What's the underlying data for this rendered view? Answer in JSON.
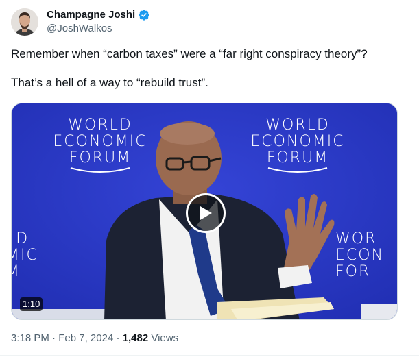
{
  "author": {
    "display_name": "Champagne Joshi",
    "handle": "@JoshWalkos",
    "verified": true,
    "avatar_icon": "profile-photo"
  },
  "tweet": {
    "lines": [
      "Remember when “carbon taxes” were a “far right conspiracy theory”?",
      "That’s a hell of a way to “rebuild trust”."
    ]
  },
  "media": {
    "type": "video",
    "duration": "1:10",
    "background_color": "#2a37c8",
    "logos": {
      "line1": "WORLD",
      "line2": "ECONOMIC",
      "line3": "FORUM",
      "left_crop": [
        "LD",
        "MIC",
        "M"
      ],
      "right_crop": [
        "WOR",
        "ECON",
        "FOR"
      ]
    },
    "play_icon": "play-icon"
  },
  "meta": {
    "time": "3:18 PM",
    "separator": "·",
    "date": "Feb 7, 2024",
    "views_count": "1,482",
    "views_label": "Views"
  },
  "colors": {
    "verified_badge": "#1d9bf0",
    "secondary_text": "#536471",
    "primary_text": "#0f1419"
  }
}
